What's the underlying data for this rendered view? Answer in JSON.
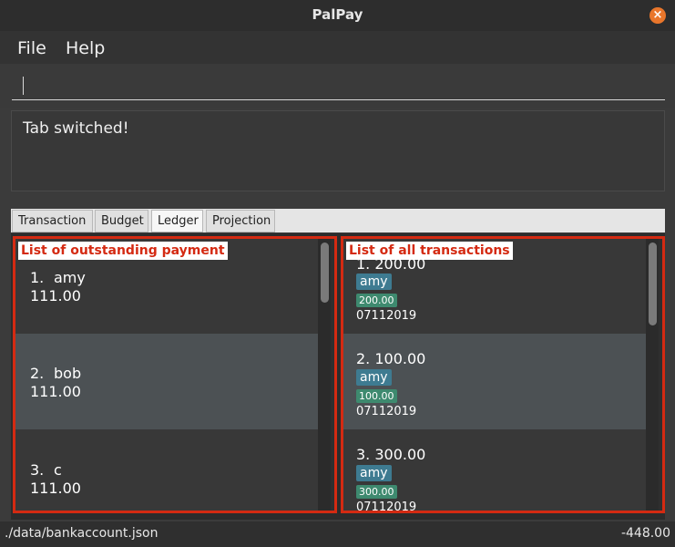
{
  "window": {
    "title": "PalPay"
  },
  "menu": {
    "file": "File",
    "help": "Help"
  },
  "command": {
    "value": ""
  },
  "result": {
    "message": "Tab switched!"
  },
  "tabs": [
    "Transaction",
    "Budget",
    "Ledger",
    "Projection"
  ],
  "active_tab": "Ledger",
  "left_pane": {
    "label": "List of outstanding payment",
    "items": [
      {
        "index": "1.",
        "name": "amy",
        "amount": "111.00"
      },
      {
        "index": "2.",
        "name": "bob",
        "amount": "111.00"
      },
      {
        "index": "3.",
        "name": "c",
        "amount": "111.00"
      }
    ]
  },
  "right_pane": {
    "label": "List of all transactions",
    "items": [
      {
        "heading": "1.  200.00",
        "person": "amy",
        "amount": "200.00",
        "date": "07112019"
      },
      {
        "heading": "2.  100.00",
        "person": "amy",
        "amount": "100.00",
        "date": "07112019"
      },
      {
        "heading": "3.  300.00",
        "person": "amy",
        "amount": "300.00",
        "date": "07112019"
      }
    ]
  },
  "status": {
    "path": "./data/bankaccount.json",
    "total": "-448.00"
  },
  "colors": {
    "highlight": "#d42a12",
    "name_tag": "#3e7b91",
    "amount_tag": "#3e8a6f",
    "close": "#e9762b"
  },
  "icons": {
    "close": "close-icon"
  }
}
